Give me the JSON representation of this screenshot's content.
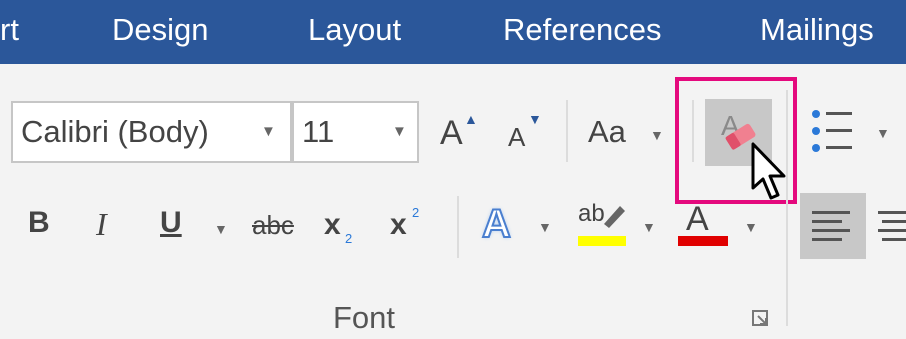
{
  "tabs": [
    "rt",
    "Design",
    "Layout",
    "References",
    "Mailings"
  ],
  "font": {
    "name": "Calibri (Body)",
    "size": "11",
    "grow_glyph": "A",
    "shrink_glyph": "A",
    "change_case": "Aa",
    "bold": "B",
    "italic": "I",
    "underline": "U",
    "strikethrough": "abc",
    "subscript_base": "x",
    "subscript_index": "2",
    "superscript_base": "x",
    "superscript_index": "2",
    "text_effects": "A",
    "highlight_glyph": "ab",
    "font_color_glyph": "A",
    "group_label": "Font"
  },
  "colors": {
    "tab_bar": "#2b579a",
    "highlight_box": "#e4097d",
    "highlight_yellow": "#ffff00",
    "font_color_red": "#e00000",
    "effects_blue": "#4a7fcf"
  }
}
